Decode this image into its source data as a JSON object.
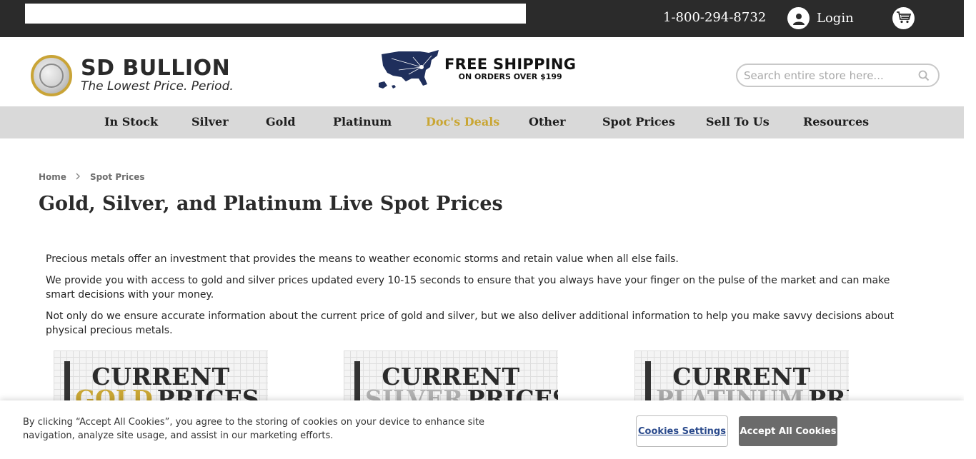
{
  "topbar": {
    "phone": "1-800-294-8732",
    "login_label": "Login"
  },
  "header": {
    "logo_name": "SD BULLION",
    "logo_tagline": "The Lowest Price. Period.",
    "shipping_title": "FREE SHIPPING",
    "shipping_subtitle": "ON ORDERS OVER $199",
    "search_placeholder": "Search entire store here..."
  },
  "nav": {
    "items": [
      "In Stock",
      "Silver",
      "Gold",
      "Platinum",
      "Doc's Deals",
      "Other",
      "Spot Prices",
      "Sell To Us",
      "Resources"
    ]
  },
  "breadcrumb": {
    "home": "Home",
    "current": "Spot Prices"
  },
  "page_title": "Gold, Silver, and Platinum Live Spot Prices",
  "paragraphs": [
    "Precious metals offer an investment that provides the means to weather economic storms and retain value when all else fails.",
    "We provide you with access to gold and silver prices updated every 10-15 seconds to ensure that you always have your finger on the pulse of the market and can make smart decisions with your money.",
    "Not only do we ensure accurate information about the current price of gold and silver, but we also deliver additional information to help you make savvy decisions about physical precious metals."
  ],
  "cards": [
    {
      "line1": "CURRENT",
      "metal": "GOLD",
      "line2": "PRICES"
    },
    {
      "line1": "CURRENT",
      "metal": "SILVER",
      "line2": "PRICES"
    },
    {
      "line1": "CURRENT",
      "metal": "PLATINUM",
      "line2": "PRICES"
    }
  ],
  "cookie": {
    "text": "By clicking “Accept All Cookies”, you agree to the storing of cookies on your device to enhance site navigation, analyze site usage, and assist in our marketing efforts.",
    "settings_label": "Cookies Settings",
    "accept_label": "Accept All Cookies"
  },
  "colors": {
    "topbar": "#2b2b2b",
    "nav_bg": "#d9d9d9",
    "deal_accent": "#c9a634",
    "map_blue": "#1f2f5c"
  },
  "icons": {
    "login": "user-circle-icon",
    "cart": "shopping-cart-icon",
    "search": "magnifier-icon",
    "breadcrumb_sep": "chevron-right-icon"
  }
}
